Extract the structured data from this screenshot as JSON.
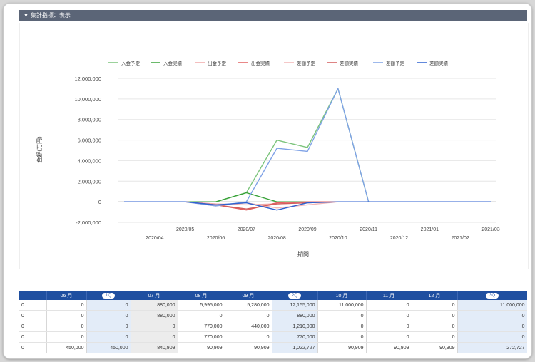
{
  "section": {
    "title": "集計指標：表示"
  },
  "chart_data": {
    "type": "line",
    "ylabel": "金額(万円)",
    "xlabel": "期間",
    "ylim": [
      -2000000,
      12000000
    ],
    "ytick_labels": [
      "12,000,000",
      "10,000,000",
      "8,000,000",
      "6,000,000",
      "4,000,000",
      "2,000,000",
      "0",
      "-2,000,000"
    ],
    "ytick_values": [
      12000000,
      10000000,
      8000000,
      6000000,
      4000000,
      2000000,
      0,
      -2000000
    ],
    "x": [
      "2020/03",
      "2020/04",
      "2020/05",
      "2020/06",
      "2020/07",
      "2020/08",
      "2020/09",
      "2020/10",
      "2020/11",
      "2020/12",
      "2021/01",
      "2021/02",
      "2021/03"
    ],
    "xtick_row1": [
      "2020/05",
      "2020/07",
      "2020/09",
      "2020/11",
      "2021/01",
      "2021/03"
    ],
    "xtick_row2": [
      "2020/04",
      "2020/06",
      "2020/08",
      "2020/10",
      "2020/12",
      "2021/02"
    ],
    "legend_position": "top",
    "grid": true,
    "series": [
      {
        "name": "入金予定",
        "color": "#7cc47c",
        "values": [
          0,
          0,
          0,
          0,
          880000,
          5995000,
          5280000,
          11000000,
          0,
          0,
          0,
          0,
          0
        ]
      },
      {
        "name": "入金実績",
        "color": "#3aa33a",
        "values": [
          0,
          0,
          0,
          0,
          880000,
          0,
          0,
          0,
          0,
          0,
          0,
          0,
          0
        ]
      },
      {
        "name": "出金予定",
        "color": "#f0a9a9",
        "values": [
          0,
          0,
          0,
          -200000,
          -300000,
          -200000,
          -100000,
          0,
          0,
          0,
          0,
          0,
          0
        ]
      },
      {
        "name": "出金実績",
        "color": "#e26060",
        "values": [
          0,
          0,
          0,
          -300000,
          -800000,
          -100000,
          0,
          0,
          0,
          0,
          0,
          0,
          0
        ]
      },
      {
        "name": "差額予定",
        "color": "#f2b6b6",
        "values": [
          0,
          0,
          0,
          -400000,
          -100000,
          -600000,
          -300000,
          0,
          0,
          0,
          0,
          0,
          0
        ]
      },
      {
        "name": "差額実績",
        "color": "#d35c5c",
        "values": [
          0,
          0,
          0,
          -300000,
          -700000,
          -200000,
          -100000,
          0,
          0,
          0,
          0,
          0,
          0
        ]
      },
      {
        "name": "差額予定",
        "color": "#7fa2e6",
        "values": [
          0,
          0,
          0,
          -400000,
          0,
          5200000,
          4900000,
          11000000,
          0,
          0,
          0,
          0,
          0
        ]
      },
      {
        "name": "差額実績",
        "color": "#2f62d0",
        "values": [
          0,
          0,
          0,
          -300000,
          -100000,
          -800000,
          -100000,
          0,
          0,
          0,
          0,
          0,
          0
        ]
      }
    ]
  },
  "table": {
    "headers": [
      "",
      "06 月",
      "1Q",
      "07 月",
      "08 月",
      "09 月",
      "2Q",
      "10 月",
      "11 月",
      "12 月",
      "3Q"
    ],
    "rows": [
      [
        "0",
        "0",
        "0",
        "880,000",
        "5,995,000",
        "5,280,000",
        "12,155,000",
        "11,000,000",
        "0",
        "0",
        "11,000,000"
      ],
      [
        "0",
        "0",
        "0",
        "880,000",
        "0",
        "0",
        "880,000",
        "0",
        "0",
        "0",
        "0"
      ],
      [
        "0",
        "0",
        "0",
        "0",
        "770,000",
        "440,000",
        "1,210,000",
        "0",
        "0",
        "0",
        "0"
      ],
      [
        "0",
        "0",
        "0",
        "0",
        "770,000",
        "0",
        "770,000",
        "0",
        "0",
        "0",
        "0"
      ],
      [
        "0",
        "450,000",
        "450,000",
        "840,909",
        "90,909",
        "90,909",
        "1,022,727",
        "90,909",
        "90,909",
        "90,909",
        "272,727"
      ]
    ]
  }
}
